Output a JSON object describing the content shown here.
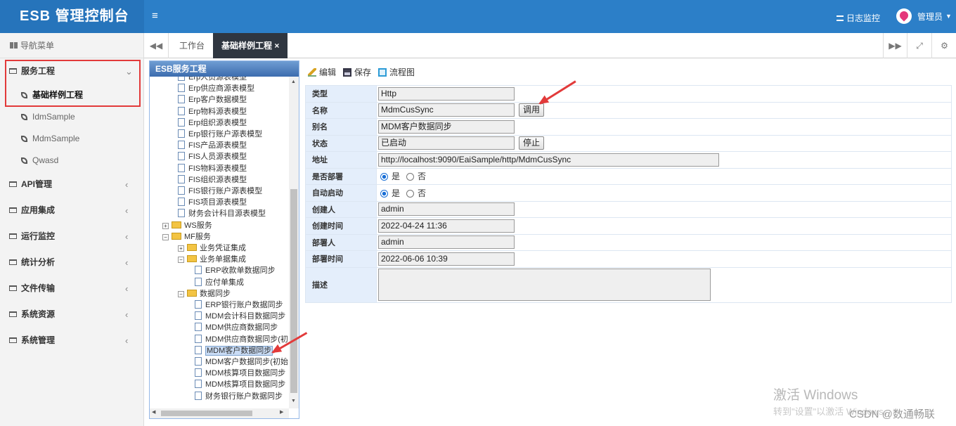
{
  "header": {
    "app_title": "ESB 管理控制台",
    "menu_toggle": "≡",
    "log_monitor": "日志监控",
    "user": "管理员"
  },
  "sidebar": {
    "header": "导航菜单",
    "groups": [
      {
        "label": "服务工程",
        "expanded": true,
        "children": [
          "基础样例工程",
          "IdmSample",
          "MdmSample",
          "Qwasd"
        ]
      },
      {
        "label": "API管理"
      },
      {
        "label": "应用集成"
      },
      {
        "label": "运行监控"
      },
      {
        "label": "统计分析"
      },
      {
        "label": "文件传输"
      },
      {
        "label": "系统资源"
      },
      {
        "label": "系统管理"
      }
    ],
    "active_item": "基础样例工程"
  },
  "tabs": {
    "items": [
      "工作台",
      "基础样例工程"
    ],
    "active": "基础样例工程",
    "close_icon": "×"
  },
  "tree": {
    "title": "ESB服务工程",
    "nodes": [
      {
        "label": "Erp人员源表模型",
        "type": "doc"
      },
      {
        "label": "Erp供应商源表模型",
        "type": "doc"
      },
      {
        "label": "Erp客户数据模型",
        "type": "doc"
      },
      {
        "label": "Erp物料源表模型",
        "type": "doc"
      },
      {
        "label": "Erp组织源表模型",
        "type": "doc"
      },
      {
        "label": "Erp银行账户源表模型",
        "type": "doc"
      },
      {
        "label": "FIS产品源表模型",
        "type": "doc"
      },
      {
        "label": "FIS人员源表模型",
        "type": "doc"
      },
      {
        "label": "FIS物料源表模型",
        "type": "doc"
      },
      {
        "label": "FIS组织源表模型",
        "type": "doc"
      },
      {
        "label": "FIS银行账户源表模型",
        "type": "doc"
      },
      {
        "label": "FIS项目源表模型",
        "type": "doc"
      },
      {
        "label": "财务会计科目源表模型",
        "type": "doc"
      },
      {
        "label": "WS服务",
        "type": "folder",
        "toggle": "+"
      },
      {
        "label": "MF服务",
        "type": "folder",
        "toggle": "−"
      },
      {
        "label": "业务凭证集成",
        "type": "folder",
        "toggle": "+"
      },
      {
        "label": "业务单据集成",
        "type": "folder",
        "toggle": "−"
      },
      {
        "label": "ERP收款单数据同步",
        "type": "doc"
      },
      {
        "label": "应付单集成",
        "type": "doc"
      },
      {
        "label": "数据同步",
        "type": "folder",
        "toggle": "−"
      },
      {
        "label": "ERP银行账户数据同步",
        "type": "doc"
      },
      {
        "label": "MDM会计科目数据同步",
        "type": "doc"
      },
      {
        "label": "MDM供应商数据同步",
        "type": "doc"
      },
      {
        "label": "MDM供应商数据同步(初",
        "type": "doc"
      },
      {
        "label": "MDM客户数据同步",
        "type": "doc",
        "selected": true
      },
      {
        "label": "MDM客户数据同步(初始",
        "type": "doc"
      },
      {
        "label": "MDM核算项目数据同步",
        "type": "doc"
      },
      {
        "label": "MDM核算项目数据同步",
        "type": "doc"
      },
      {
        "label": "财务银行账户数据同步",
        "type": "doc"
      }
    ]
  },
  "toolbar": {
    "edit": "编辑",
    "save": "保存",
    "flow": "流程图"
  },
  "form": {
    "type_label": "类型",
    "type_value": "Http",
    "name_label": "名称",
    "name_value": "MdmCusSync",
    "invoke_button": "调用",
    "alias_label": "别名",
    "alias_value": "MDM客户数据同步",
    "status_label": "状态",
    "status_value": "已启动",
    "stop_button": "停止",
    "address_label": "地址",
    "address_value": "http://localhost:9090/EaiSample/http/MdmCusSync",
    "deployed_label": "是否部署",
    "auto_start_label": "自动启动",
    "yes": "是",
    "no": "否",
    "creator_label": "创建人",
    "creator_value": "admin",
    "created_label": "创建时间",
    "created_value": "2022-04-24 11:36",
    "deployer_label": "部署人",
    "deployer_value": "admin",
    "deployed_time_label": "部署时间",
    "deployed_time_value": "2022-06-06 10:39",
    "desc_label": "描述",
    "desc_value": ""
  },
  "watermark": {
    "line1": "激活 Windows",
    "line2": "转到\"设置\"以激活 Windows。",
    "credit": "CSDN @数通畅联"
  },
  "colors": {
    "topbar": "#2c7fc8",
    "annotation": "#e23a3a",
    "label_bg": "#e4eefb"
  }
}
